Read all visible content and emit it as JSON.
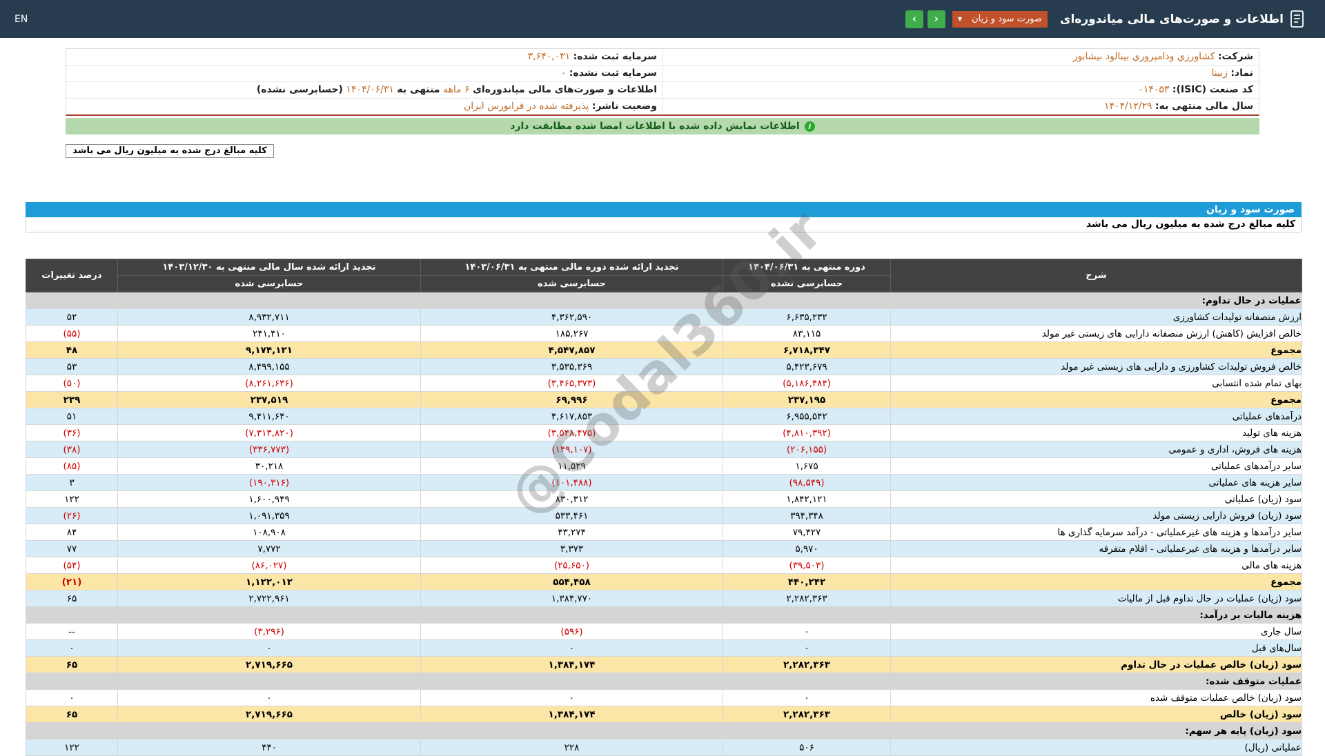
{
  "topbar": {
    "en_label": "EN",
    "title": "اطلاعات و صورت‌های مالی میاندوره‌ای",
    "report_select": {
      "value": "صورت سود و زیان",
      "caret": "▼"
    },
    "nav": {
      "prev_glyph": "‹",
      "next_glyph": "›"
    }
  },
  "company_info": {
    "rows": [
      {
        "right": [
          {
            "k": "label",
            "t": "شرکت:"
          },
          {
            "k": "val",
            "t": "کشاورزي ودامپروري بينالود نيشابور"
          }
        ],
        "left": [
          {
            "k": "label",
            "t": "سرمایه ثبت شده:"
          },
          {
            "k": "val",
            "t": "۳,۶۴۰,۰۳۱"
          }
        ]
      },
      {
        "right": [
          {
            "k": "label",
            "t": "نماد:"
          },
          {
            "k": "val",
            "t": "زبينا"
          }
        ],
        "left": [
          {
            "k": "label",
            "t": "سرمایه ثبت نشده:"
          },
          {
            "k": "val",
            "t": "۰"
          }
        ]
      },
      {
        "right": [
          {
            "k": "label",
            "t": "کد صنعت (ISIC):"
          },
          {
            "k": "val",
            "t": "۰۱۴۰۵۳"
          }
        ],
        "left": [
          {
            "k": "label",
            "t": "اطلاعات و صورت‌های مالی میاندوره‌ای"
          },
          {
            "k": "val",
            "t": "۶ ماهه"
          },
          {
            "k": "plain",
            "t": "منتهی به"
          },
          {
            "k": "val",
            "t": "۱۴۰۴/۰۶/۳۱"
          },
          {
            "k": "plain",
            "t": "(حسابرسی نشده)"
          }
        ]
      },
      {
        "right": [
          {
            "k": "label",
            "t": "سال مالی منتهی به:"
          },
          {
            "k": "val",
            "t": "۱۴۰۴/۱۲/۲۹"
          }
        ],
        "left": [
          {
            "k": "label",
            "t": "وضعیت ناشر:"
          },
          {
            "k": "val",
            "t": "پذيرفته شده در فرابورس ايران"
          }
        ]
      }
    ]
  },
  "signature_banner": {
    "icon_glyph": "i",
    "text": "اطلاعات نمایش داده شده با اطلاعات امضا شده مطابقت دارد"
  },
  "unit_note_box": {
    "text": "کلیه مبالغ درج شده به میلیون ریال می باشد"
  },
  "statement": {
    "title": "صورت سود و زیان",
    "unit_note": "کلیه مبالغ درج شده به میلیون ریال می باشد",
    "watermark": "@Codal360.ir",
    "colors": {
      "accent_blue": "#1e9cd7",
      "row_blue": "#d7ecf6",
      "row_yellow": "#fbe6a7",
      "negative_red": "#d10000",
      "value_orange": "#bf6c28"
    },
    "table": {
      "headers": {
        "desc": "شرح",
        "current": {
          "title": "دوره منتهی به ۱۴۰۴/۰۶/۳۱",
          "audit": "حسابرسی نشده"
        },
        "prior_period": {
          "title": "تجدید ارائه شده دوره مالی منتهی به ۱۴۰۳/۰۶/۳۱",
          "audit": "حسابرسی شده"
        },
        "prior_year": {
          "title": "تجدید ارائه شده سال مالی منتهی به ۱۴۰۳/۱۲/۳۰",
          "audit": "حسابرسی شده"
        },
        "change_pct": "درصد تغییرات"
      },
      "rows": [
        {
          "type": "section",
          "desc": "عملیات در حال تداوم:"
        },
        {
          "type": "row",
          "bg": "blue",
          "desc": "ارزش منصفانه تولیدات کشاورزی",
          "v1": "۶,۶۳۵,۲۳۲",
          "v2": "۴,۳۶۲,۵۹۰",
          "v3": "۸,۹۳۲,۷۱۱",
          "pct": "۵۲"
        },
        {
          "type": "row",
          "bg": "white",
          "desc": "خالص افزایش (کاهش) ارزش منصفانه دارایی های زیستی غیر مولد",
          "v1": "۸۳,۱۱۵",
          "v2": "۱۸۵,۲۶۷",
          "v3": "۲۴۱,۴۱۰",
          "pct": "(۵۵)"
        },
        {
          "type": "row",
          "bg": "yellow",
          "bold": true,
          "desc": "مجموع",
          "v1": "۶,۷۱۸,۳۴۷",
          "v2": "۴,۵۴۷,۸۵۷",
          "v3": "۹,۱۷۴,۱۲۱",
          "pct": "۴۸"
        },
        {
          "type": "row",
          "bg": "blue",
          "desc": "خالص فروش تولیدات کشاورزی و دارایی های زیستی غیر مولد",
          "v1": "۵,۴۲۳,۶۷۹",
          "v2": "۳,۵۳۵,۳۶۹",
          "v3": "۸,۴۹۹,۱۵۵",
          "pct": "۵۳"
        },
        {
          "type": "row",
          "bg": "white",
          "desc": "بهای تمام شده انتسابی",
          "v1": "(۵,۱۸۶,۴۸۴)",
          "v2": "(۳,۴۶۵,۳۷۳)",
          "v3": "(۸,۲۶۱,۶۳۶)",
          "pct": "(۵۰)"
        },
        {
          "type": "row",
          "bg": "yellow",
          "bold": true,
          "desc": "مجموع",
          "v1": "۲۳۷,۱۹۵",
          "v2": "۶۹,۹۹۶",
          "v3": "۲۳۷,۵۱۹",
          "pct": "۲۳۹"
        },
        {
          "type": "row",
          "bg": "blue",
          "desc": "درآمدهای عملیاتی",
          "v1": "۶,۹۵۵,۵۴۲",
          "v2": "۴,۶۱۷,۸۵۳",
          "v3": "۹,۴۱۱,۶۴۰",
          "pct": "۵۱"
        },
        {
          "type": "row",
          "bg": "white",
          "desc": "هزینه های تولید",
          "v1": "(۴,۸۱۰,۳۹۲)",
          "v2": "(۳,۵۴۸,۴۷۵)",
          "v3": "(۷,۳۱۳,۸۲۰)",
          "pct": "(۳۶)"
        },
        {
          "type": "row",
          "bg": "blue",
          "desc": "هزینه های فروش، اداری و عمومی",
          "v1": "(۲۰۶,۱۵۵)",
          "v2": "(۱۴۹,۱۰۷)",
          "v3": "(۳۳۶,۷۷۳)",
          "pct": "(۳۸)"
        },
        {
          "type": "row",
          "bg": "white",
          "desc": "سایر درآمدهای عملیاتی",
          "v1": "۱,۶۷۵",
          "v2": "۱۱,۵۲۹",
          "v3": "۳۰,۲۱۸",
          "pct": "(۸۵)"
        },
        {
          "type": "row",
          "bg": "blue",
          "desc": "سایر هزینه های عملیاتی",
          "v1": "(۹۸,۵۴۹)",
          "v2": "(۱۰۱,۴۸۸)",
          "v3": "(۱۹۰,۳۱۶)",
          "pct": "۳"
        },
        {
          "type": "row",
          "bg": "white",
          "desc": "سود (زیان) عملیاتی",
          "v1": "۱,۸۴۲,۱۲۱",
          "v2": "۸۳۰,۳۱۲",
          "v3": "۱,۶۰۰,۹۴۹",
          "pct": "۱۲۲"
        },
        {
          "type": "row",
          "bg": "blue",
          "desc": "سود (زیان) فروش دارایی زیستی مولد",
          "v1": "۳۹۴,۳۴۸",
          "v2": "۵۳۳,۴۶۱",
          "v3": "۱,۰۹۱,۳۵۹",
          "pct": "(۲۶)"
        },
        {
          "type": "row",
          "bg": "white",
          "desc": "سایر درآمدها و هزینه های غیرعملیاتی - درآمد سرمایه گذاری ها",
          "v1": "۷۹,۴۲۷",
          "v2": "۴۳,۲۷۴",
          "v3": "۱۰۸,۹۰۸",
          "pct": "۸۴"
        },
        {
          "type": "row",
          "bg": "blue",
          "desc": "سایر درآمدها و هزینه های غیرعملیاتی - اقلام متفرقه",
          "v1": "۵,۹۷۰",
          "v2": "۳,۳۷۳",
          "v3": "۷,۷۷۲",
          "pct": "۷۷"
        },
        {
          "type": "row",
          "bg": "white",
          "desc": "هزینه های مالی",
          "v1": "(۳۹,۵۰۳)",
          "v2": "(۲۵,۶۵۰)",
          "v3": "(۸۶,۰۲۷)",
          "pct": "(۵۴)"
        },
        {
          "type": "row",
          "bg": "yellow",
          "bold": true,
          "desc": "مجموع",
          "v1": "۴۴۰,۲۴۲",
          "v2": "۵۵۴,۴۵۸",
          "v3": "۱,۱۲۲,۰۱۲",
          "pct": "(۲۱)"
        },
        {
          "type": "row",
          "bg": "blue",
          "desc": "سود (زیان) عملیات در حال تداوم قبل از مالیات",
          "v1": "۲,۲۸۲,۳۶۳",
          "v2": "۱,۳۸۴,۷۷۰",
          "v3": "۲,۷۲۲,۹۶۱",
          "pct": "۶۵"
        },
        {
          "type": "section",
          "desc": "هزینه مالیات بر درآمد:"
        },
        {
          "type": "row",
          "bg": "white",
          "desc": "سال جاری",
          "v1": "۰",
          "v2": "(۵۹۶)",
          "v3": "(۳,۲۹۶)",
          "pct": "--"
        },
        {
          "type": "row",
          "bg": "blue",
          "desc": "سال‌های قبل",
          "v1": "۰",
          "v2": "۰",
          "v3": "۰",
          "pct": "۰"
        },
        {
          "type": "row",
          "bg": "yellow",
          "bold": true,
          "desc": "سود (زیان) خالص عملیات در حال تداوم",
          "v1": "۲,۲۸۲,۳۶۳",
          "v2": "۱,۳۸۴,۱۷۴",
          "v3": "۲,۷۱۹,۶۶۵",
          "pct": "۶۵"
        },
        {
          "type": "section",
          "desc": "عملیات متوقف شده:"
        },
        {
          "type": "row",
          "bg": "white",
          "desc": "سود (زیان) خالص عملیات متوقف شده",
          "v1": "۰",
          "v2": "۰",
          "v3": "۰",
          "pct": "۰"
        },
        {
          "type": "row",
          "bg": "yellow",
          "bold": true,
          "desc": "سود (زیان) خالص",
          "v1": "۲,۲۸۲,۳۶۳",
          "v2": "۱,۳۸۴,۱۷۴",
          "v3": "۲,۷۱۹,۶۶۵",
          "pct": "۶۵"
        },
        {
          "type": "section",
          "desc": "سود (زیان) پایه هر سهم:"
        },
        {
          "type": "row",
          "bg": "blue",
          "desc": "عملیاتی (ریال)",
          "v1": "۵۰۶",
          "v2": "۲۲۸",
          "v3": "۴۴۰",
          "pct": "۱۲۲"
        }
      ]
    }
  }
}
